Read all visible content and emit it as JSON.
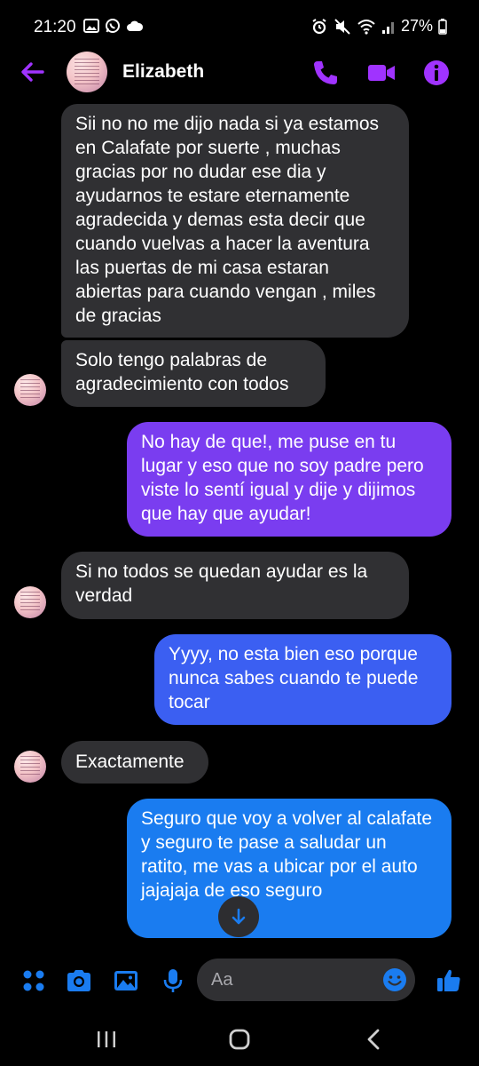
{
  "status_bar": {
    "time": "21:20",
    "battery": "27%"
  },
  "header": {
    "contact_name": "Elizabeth"
  },
  "messages": [
    {
      "from": "them",
      "text": "Sii no no me dijo nada si ya estamos en Calafate por suerte , muchas gracias por no dudar ese dia y ayudarnos te estare eternamente agradecida y demas esta decir que cuando vuelvas a hacer la aventura las puertas de mi casa estaran abiertas para cuando vengan , miles de gracias"
    },
    {
      "from": "them",
      "text": "Solo tengo palabras de agradecimiento con todos"
    },
    {
      "from": "me",
      "text": "No hay de que!, me puse en tu lugar y eso que no soy padre pero viste lo sentí igual  y dije y dijimos que hay que ayudar!"
    },
    {
      "from": "them",
      "text": "Si no todos se quedan ayudar es la verdad"
    },
    {
      "from": "me",
      "text": "Yyyy, no esta bien eso porque nunca sabes cuando te puede tocar"
    },
    {
      "from": "them",
      "text": "Exactamente"
    },
    {
      "from": "me",
      "text": "Seguro que voy a volver al calafate y seguro te pase a saludar un ratito, me vas a ubicar por el auto jajajaja de eso seguro"
    }
  ],
  "composer": {
    "placeholder": "Aa"
  },
  "colors": {
    "accent": "#a033ff",
    "incoming_bubble": "#303033",
    "outgoing_purple": "#7a3df0",
    "outgoing_blue": "#1a7cf0",
    "composer_icon": "#1a7cf0"
  }
}
